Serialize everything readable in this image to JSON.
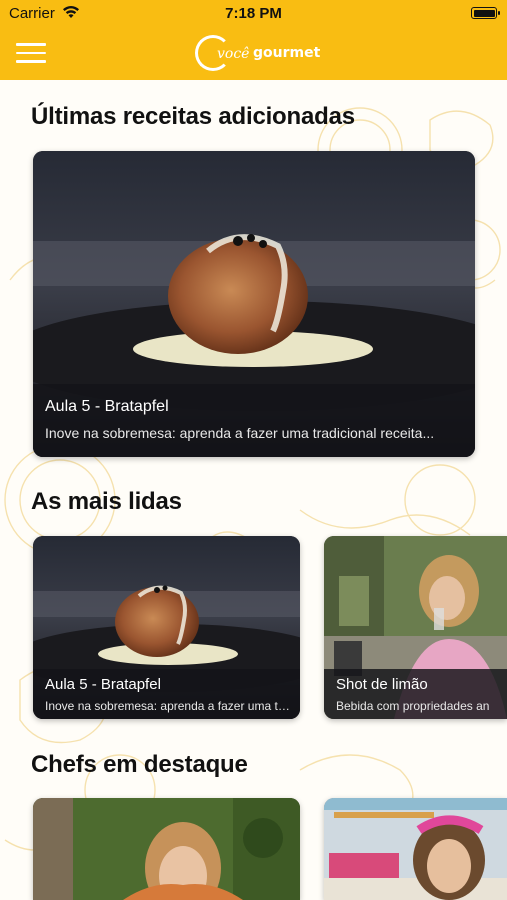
{
  "status_bar": {
    "carrier": "Carrier",
    "time": "7:18 PM"
  },
  "header": {
    "logo_voce": "você",
    "logo_gourmet": "gourmet",
    "brand_color": "#f9bd12"
  },
  "latest": {
    "title": "Últimas receitas adicionadas",
    "card": {
      "title": "Aula 5 - Bratapfel",
      "subtitle": "Inove na sobremesa: aprenda a fazer uma tradicional receita..."
    }
  },
  "most_read": {
    "title": "As mais lidas",
    "cards": [
      {
        "title": "Aula 5 - Bratapfel",
        "subtitle": "Inove na sobremesa: aprenda a fazer uma tr..."
      },
      {
        "title": "Shot de limão",
        "subtitle": "Bebida com propriedades an"
      }
    ]
  },
  "chefs": {
    "title": "Chefs em destaque"
  }
}
